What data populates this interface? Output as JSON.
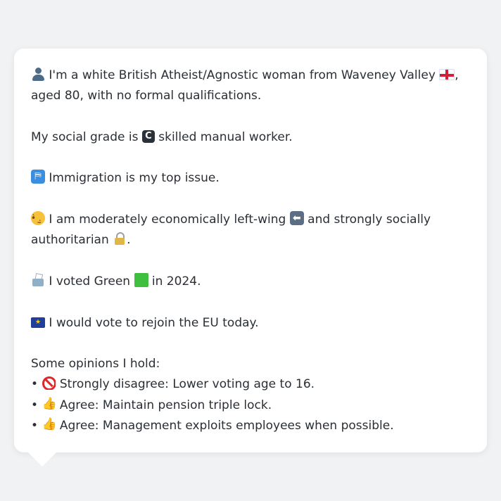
{
  "profile": {
    "intro_line1": "I'm a white British Atheist/Agnostic woman from Waveney Valley",
    "intro_line1_end": ",",
    "intro_line2": "aged 80, with no formal qualifications.",
    "social_grade_prefix": "My social grade is",
    "social_grade_value": "skilled manual worker.",
    "top_issue": "Immigration is my top issue.",
    "econ_prefix": "I am moderately economically left-wing",
    "econ_suffix": "and strongly socially",
    "social_line2": "authoritarian",
    "social_line2_end": ".",
    "vote_prefix": "I voted Green",
    "vote_suffix": "in 2024.",
    "eu": "I would vote to rejoin the EU today.",
    "opinions_heading": "Some opinions I hold:",
    "opinions": [
      {
        "bullet": "•",
        "icon": "no-entry-icon",
        "text": "Strongly disagree: Lower voting age to 16."
      },
      {
        "bullet": "•",
        "icon": "thumbs-up-icon",
        "text": "Agree: Maintain pension triple lock."
      },
      {
        "bullet": "•",
        "icon": "thumbs-up-icon",
        "text": "Agree: Management exploits employees when possible."
      }
    ]
  },
  "icons": {
    "person": "bust-in-silhouette-icon",
    "flag": "england-flag-icon",
    "grade": "letter-c-icon",
    "passport": "passport-control-icon",
    "thinking": "thinking-face-icon",
    "arrow": "left-arrow-icon",
    "lock": "lock-icon",
    "ballot": "ballot-box-icon",
    "green": "green-square-icon",
    "eu_flag": "eu-flag-icon",
    "c_letter": "C",
    "eu_stars": "★",
    "arrow_glyph": "⬅",
    "thumb_glyph": "👍"
  },
  "colors": {
    "background": "#f0f2f4",
    "bubble": "#ffffff",
    "text": "#2a2f35",
    "green_party": "#3fbf3f",
    "eu_blue": "#1f3f9a"
  }
}
